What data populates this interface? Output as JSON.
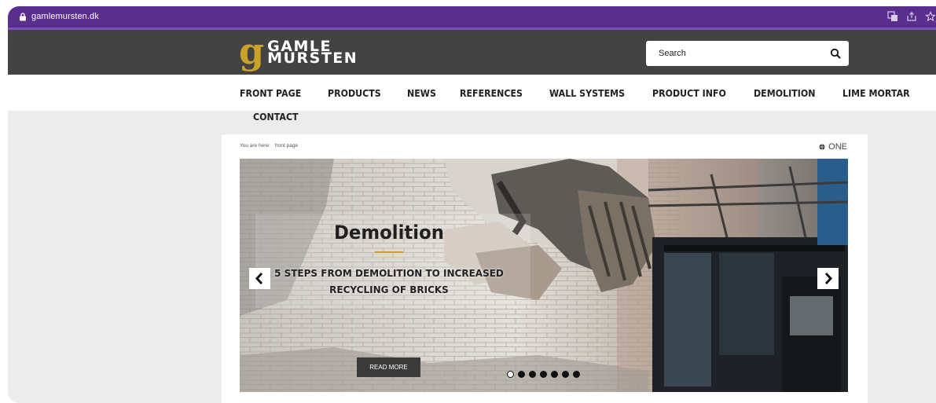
{
  "browser": {
    "url": "gamlemursten.dk"
  },
  "site": {
    "logo_mark": "g",
    "logo_line1": "GAMLE",
    "logo_line2": "MURSTEN"
  },
  "search": {
    "placeholder": "Search"
  },
  "nav": {
    "items": [
      {
        "label": "FRONT PAGE"
      },
      {
        "label": "PRODUCTS"
      },
      {
        "label": "NEWS"
      },
      {
        "label": "REFERENCES"
      },
      {
        "label": "WALL SYSTEMS"
      },
      {
        "label": "PRODUCT INFO"
      },
      {
        "label": "DEMOLITION"
      },
      {
        "label": "LIME MORTAR"
      },
      {
        "label": "CONTACT"
      }
    ]
  },
  "breadcrumb": {
    "prefix": "You are here:",
    "current": "front page"
  },
  "language": {
    "label": "ONE"
  },
  "slider": {
    "title": "Demolition",
    "subtitle_line1": "5 STEPS FROM DEMOLITION TO INCREASED",
    "subtitle_line2": "RECYCLING OF BRICKS",
    "button_label": "READ MORE",
    "slide_count": 7,
    "active_slide": 1
  },
  "colors": {
    "browser_bar": "#5a2e8c",
    "header": "#434343",
    "accent": "#c9a22a",
    "page_bg": "#ececec"
  }
}
